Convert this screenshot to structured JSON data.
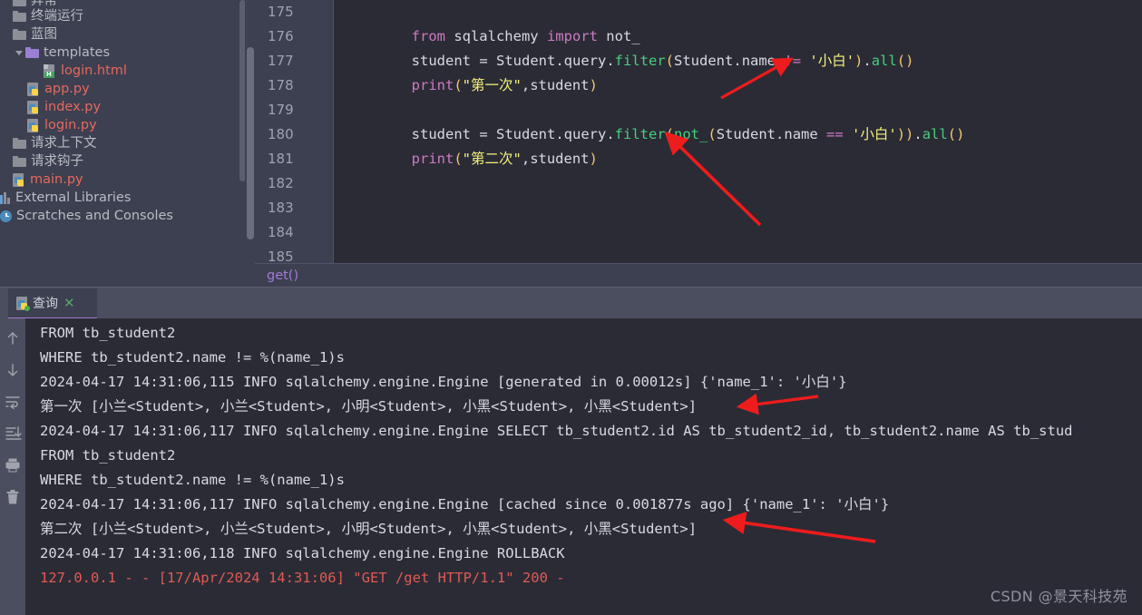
{
  "sidebar": {
    "items": [
      {
        "label": "异常",
        "icon": "folder-icon",
        "indent": 14,
        "kind": "folder",
        "clipped": true
      },
      {
        "label": "终端运行",
        "icon": "folder-icon",
        "indent": 14,
        "kind": "folder"
      },
      {
        "label": "蓝图",
        "icon": "folder-icon",
        "indent": 14,
        "kind": "folder"
      },
      {
        "label": "templates",
        "icon": "folder-open-icon",
        "indent": 14,
        "kind": "folder-purple",
        "expanded": true
      },
      {
        "label": "login.html",
        "icon": "html-file-icon",
        "indent": 48,
        "kind": "html"
      },
      {
        "label": "app.py",
        "icon": "python-file-icon",
        "indent": 30,
        "kind": "py"
      },
      {
        "label": "index.py",
        "icon": "python-file-icon",
        "indent": 30,
        "kind": "py"
      },
      {
        "label": "login.py",
        "icon": "python-file-icon",
        "indent": 30,
        "kind": "py"
      },
      {
        "label": "请求上下文",
        "icon": "folder-icon",
        "indent": 14,
        "kind": "folder"
      },
      {
        "label": "请求钩子",
        "icon": "folder-icon",
        "indent": 14,
        "kind": "folder"
      },
      {
        "label": "main.py",
        "icon": "python-file-icon",
        "indent": 14,
        "kind": "py"
      },
      {
        "label": "External Libraries",
        "icon": "library-icon",
        "indent": 0,
        "kind": "plain"
      },
      {
        "label": "Scratches and Consoles",
        "icon": "scratches-icon",
        "indent": 0,
        "kind": "plain"
      }
    ]
  },
  "editor": {
    "line_numbers": [
      "175",
      "176",
      "177",
      "178",
      "179",
      "180",
      "181",
      "182",
      "183",
      "184",
      "185"
    ],
    "lines": [
      {
        "n": "175",
        "tokens": []
      },
      {
        "n": "176",
        "tokens": [
          {
            "t": "        ",
            "c": "dflt"
          },
          {
            "t": "from",
            "c": "kw"
          },
          {
            "t": " sqlalchemy ",
            "c": "dflt"
          },
          {
            "t": "import",
            "c": "kw"
          },
          {
            "t": " not_",
            "c": "dflt"
          }
        ]
      },
      {
        "n": "177",
        "tokens": [
          {
            "t": "        student ",
            "c": "dflt"
          },
          {
            "t": "=",
            "c": "dflt"
          },
          {
            "t": " Student",
            "c": "dflt"
          },
          {
            "t": ".",
            "c": "dflt"
          },
          {
            "t": "query",
            "c": "dflt"
          },
          {
            "t": ".",
            "c": "dflt"
          },
          {
            "t": "filter",
            "c": "fn"
          },
          {
            "t": "(",
            "c": "pn"
          },
          {
            "t": "Student",
            "c": "dflt"
          },
          {
            "t": ".",
            "c": "dflt"
          },
          {
            "t": "name ",
            "c": "dflt"
          },
          {
            "t": "!=",
            "c": "op"
          },
          {
            "t": " ",
            "c": "dflt"
          },
          {
            "t": "'小白'",
            "c": "str"
          },
          {
            "t": ")",
            "c": "pn"
          },
          {
            "t": ".",
            "c": "dflt"
          },
          {
            "t": "all",
            "c": "fn"
          },
          {
            "t": "()",
            "c": "pn"
          }
        ]
      },
      {
        "n": "178",
        "tokens": [
          {
            "t": "        ",
            "c": "dflt"
          },
          {
            "t": "print",
            "c": "kw"
          },
          {
            "t": "(",
            "c": "pn"
          },
          {
            "t": "\"第一次\"",
            "c": "str"
          },
          {
            "t": ",",
            "c": "dflt"
          },
          {
            "t": "student",
            "c": "dflt"
          },
          {
            "t": ")",
            "c": "pn"
          }
        ]
      },
      {
        "n": "179",
        "tokens": []
      },
      {
        "n": "180",
        "tokens": [
          {
            "t": "        student ",
            "c": "dflt"
          },
          {
            "t": "=",
            "c": "dflt"
          },
          {
            "t": " Student",
            "c": "dflt"
          },
          {
            "t": ".",
            "c": "dflt"
          },
          {
            "t": "query",
            "c": "dflt"
          },
          {
            "t": ".",
            "c": "dflt"
          },
          {
            "t": "filter",
            "c": "fn"
          },
          {
            "t": "(",
            "c": "pn"
          },
          {
            "t": "not_",
            "c": "fn"
          },
          {
            "t": "(",
            "c": "pn"
          },
          {
            "t": "Student",
            "c": "dflt"
          },
          {
            "t": ".",
            "c": "dflt"
          },
          {
            "t": "name ",
            "c": "dflt"
          },
          {
            "t": "==",
            "c": "op"
          },
          {
            "t": " ",
            "c": "dflt"
          },
          {
            "t": "'小白'",
            "c": "str"
          },
          {
            "t": "))",
            "c": "pn"
          },
          {
            "t": ".",
            "c": "dflt"
          },
          {
            "t": "all",
            "c": "fn"
          },
          {
            "t": "()",
            "c": "pn"
          }
        ]
      },
      {
        "n": "181",
        "tokens": [
          {
            "t": "        ",
            "c": "dflt"
          },
          {
            "t": "print",
            "c": "kw"
          },
          {
            "t": "(",
            "c": "pn"
          },
          {
            "t": "\"第二次\"",
            "c": "str"
          },
          {
            "t": ",",
            "c": "dflt"
          },
          {
            "t": "student",
            "c": "dflt"
          },
          {
            "t": ")",
            "c": "pn"
          }
        ]
      },
      {
        "n": "182",
        "tokens": []
      },
      {
        "n": "183",
        "tokens": []
      },
      {
        "n": "184",
        "tokens": []
      },
      {
        "n": "185",
        "tokens": []
      }
    ],
    "breadcrumb": "get()"
  },
  "console": {
    "tab": {
      "label": "查询",
      "close": "✕",
      "icon": "python-run-icon"
    },
    "tools": [
      {
        "name": "scroll-up-icon",
        "title": "Up"
      },
      {
        "name": "scroll-down-icon",
        "title": "Down"
      },
      {
        "name": "soft-wrap-icon",
        "title": "Soft-Wrap"
      },
      {
        "name": "scroll-to-end-icon",
        "title": "Scroll to End"
      },
      {
        "name": "print-icon",
        "title": "Print"
      },
      {
        "name": "trash-icon",
        "title": "Clear All"
      }
    ],
    "output": [
      {
        "text": "FROM tb_student2",
        "color": "normal"
      },
      {
        "text": "WHERE tb_student2.name != %(name_1)s",
        "color": "normal"
      },
      {
        "text": "2024-04-17 14:31:06,115 INFO sqlalchemy.engine.Engine [generated in 0.00012s] {'name_1': '小白'}",
        "color": "normal"
      },
      {
        "text": "第一次 [小兰<Student>, 小兰<Student>, 小明<Student>, 小黑<Student>, 小黑<Student>]",
        "color": "normal"
      },
      {
        "text": "2024-04-17 14:31:06,117 INFO sqlalchemy.engine.Engine SELECT tb_student2.id AS tb_student2_id, tb_student2.name AS tb_stud",
        "color": "normal"
      },
      {
        "text": "FROM tb_student2",
        "color": "normal"
      },
      {
        "text": "WHERE tb_student2.name != %(name_1)s",
        "color": "normal"
      },
      {
        "text": "2024-04-17 14:31:06,117 INFO sqlalchemy.engine.Engine [cached since 0.001877s ago] {'name_1': '小白'}",
        "color": "normal"
      },
      {
        "text": "第二次 [小兰<Student>, 小兰<Student>, 小明<Student>, 小黑<Student>, 小黑<Student>]",
        "color": "normal"
      },
      {
        "text": "2024-04-17 14:31:06,118 INFO sqlalchemy.engine.Engine ROLLBACK",
        "color": "normal"
      },
      {
        "text": "127.0.0.1 - - [17/Apr/2024 14:31:06] \"GET /get HTTP/1.1\" 200 -",
        "color": "red"
      }
    ]
  },
  "watermark": "CSDN @景天科技苑",
  "colors": {
    "accent_purple": "#a678d8",
    "annotation_red": "#ee1c1c",
    "error_text": "#e05a52",
    "editor_bg": "#2b2b36",
    "panel_bg": "#4a4e5e",
    "tree_bg": "#3c4050"
  }
}
